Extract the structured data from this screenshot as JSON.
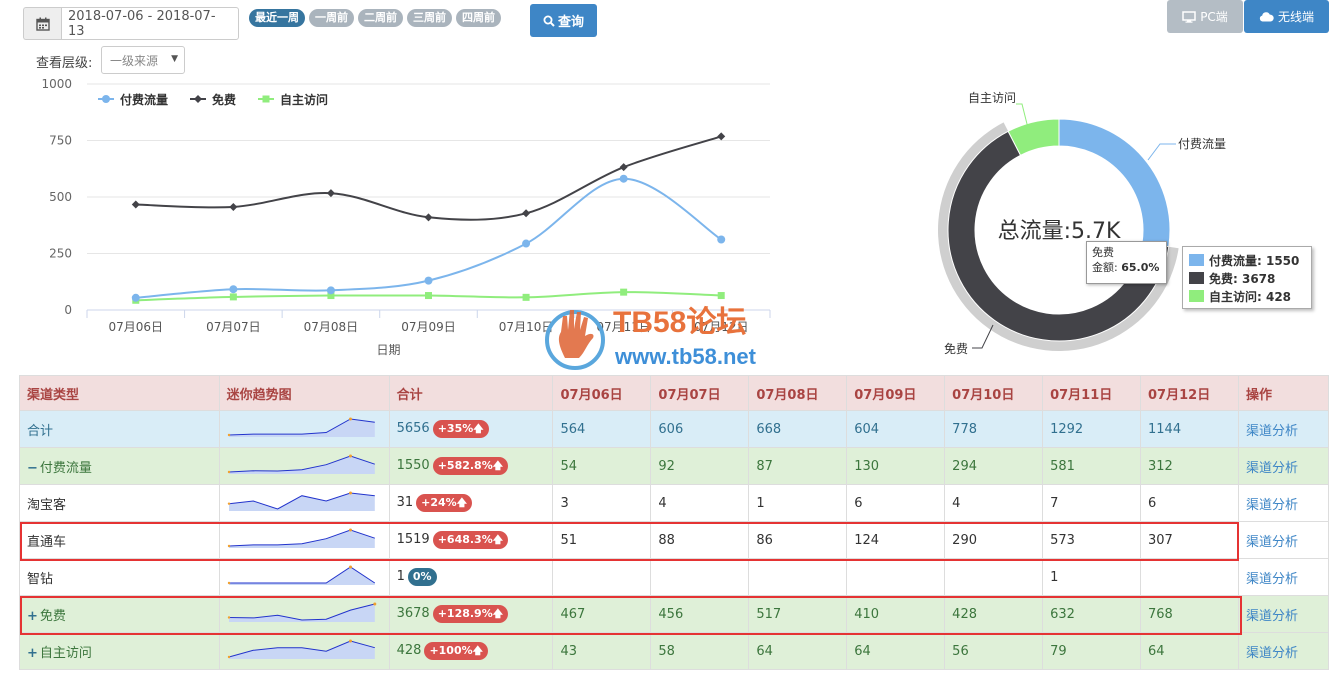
{
  "toolbar": {
    "date_range": "2018-07-06 - 2018-07-13",
    "pills": [
      "最近一周",
      "一周前",
      "二周前",
      "三周前",
      "四周前"
    ],
    "query_label": "查询",
    "pc_label": "PC端",
    "mobile_label": "无线端"
  },
  "filter": {
    "level_label": "查看层级:",
    "level_value": "一级来源"
  },
  "chart_data": [
    {
      "type": "line",
      "categories": [
        "07月06日",
        "07月07日",
        "07月08日",
        "07月09日",
        "07月10日",
        "07月11日",
        "07月12日"
      ],
      "series": [
        {
          "name": "付费流量",
          "values": [
            54,
            92,
            87,
            130,
            294,
            581,
            312
          ],
          "color": "#7cb5ec"
        },
        {
          "name": "免费",
          "values": [
            467,
            456,
            517,
            410,
            428,
            632,
            768
          ],
          "color": "#434348"
        },
        {
          "name": "自主访问",
          "values": [
            43,
            58,
            64,
            64,
            56,
            79,
            64
          ],
          "color": "#90ed7d"
        }
      ],
      "yticks": [
        0,
        250,
        500,
        750,
        1000
      ],
      "ylim": [
        0,
        1000
      ],
      "xlabel": "日期",
      "legend": "top-left"
    },
    {
      "type": "pie",
      "center_label": "总流量:5.7K",
      "slices": [
        {
          "name": "付费流量",
          "value": 1550,
          "color": "#7cb5ec"
        },
        {
          "name": "免费",
          "value": 3678,
          "color": "#434348"
        },
        {
          "name": "自主访问",
          "value": 428,
          "color": "#90ed7d"
        }
      ],
      "legend": [
        {
          "label": "付费流量: 1550"
        },
        {
          "label": "免费: 3678"
        },
        {
          "label": "自主访问: 428"
        }
      ],
      "tooltip": {
        "name": "免费",
        "metric": "金额",
        "value": "65.0%"
      }
    }
  ],
  "watermark": {
    "line1": "TB58论坛",
    "line2": "www.tb58.net"
  },
  "table": {
    "headers": [
      "渠道类型",
      "迷你趋势图",
      "合计",
      "07月06日",
      "07月07日",
      "07月08日",
      "07月09日",
      "07月10日",
      "07月11日",
      "07月12日",
      "操作"
    ],
    "rows": [
      {
        "cls": "total",
        "name": "合计",
        "expand": "",
        "total": "5656",
        "change": "+35%",
        "up": true,
        "days": [
          "564",
          "606",
          "668",
          "604",
          "778",
          "1292",
          "1144"
        ],
        "op": "渠道分析",
        "spark": [
          564,
          606,
          606,
          604,
          680,
          1292,
          1144
        ]
      },
      {
        "cls": "paid",
        "name": "付费流量",
        "expand": "−",
        "total": "1550",
        "change": "+582.8%",
        "up": true,
        "days": [
          "54",
          "92",
          "87",
          "130",
          "294",
          "581",
          "312"
        ],
        "op": "渠道分析",
        "spark": [
          54,
          92,
          87,
          130,
          294,
          581,
          312
        ]
      },
      {
        "cls": "plain",
        "name": "淘宝客",
        "expand": "",
        "total": "31",
        "change": "+24%",
        "up": true,
        "days": [
          "3",
          "4",
          "1",
          "6",
          "4",
          "7",
          "6"
        ],
        "op": "渠道分析",
        "spark": [
          3,
          4,
          1,
          6,
          4,
          7,
          6
        ]
      },
      {
        "cls": "plain",
        "name": "直通车",
        "expand": "",
        "total": "1519",
        "change": "+648.3%",
        "up": true,
        "days": [
          "51",
          "88",
          "86",
          "124",
          "290",
          "573",
          "307"
        ],
        "op": "渠道分析",
        "spark": [
          51,
          88,
          86,
          124,
          290,
          573,
          307
        ]
      },
      {
        "cls": "plain",
        "name": "智钻",
        "expand": "",
        "total": "1",
        "change": "0%",
        "up": false,
        "days": [
          "",
          "",
          "",
          "",
          "",
          "1",
          ""
        ],
        "op": "渠道分析",
        "spark": [
          0,
          0,
          0,
          0,
          0,
          1,
          0
        ]
      },
      {
        "cls": "free",
        "name": "免费",
        "expand": "+",
        "total": "3678",
        "change": "+128.9%",
        "up": true,
        "days": [
          "467",
          "456",
          "517",
          "410",
          "428",
          "632",
          "768"
        ],
        "op": "渠道分析",
        "spark": [
          467,
          456,
          517,
          410,
          428,
          632,
          768
        ]
      },
      {
        "cls": "self",
        "name": "自主访问",
        "expand": "+",
        "total": "428",
        "change": "+100%",
        "up": true,
        "days": [
          "43",
          "58",
          "64",
          "64",
          "56",
          "79",
          "64"
        ],
        "op": "渠道分析",
        "spark": [
          43,
          58,
          64,
          64,
          56,
          79,
          64
        ]
      }
    ]
  },
  "colors": {
    "primary": "#3e86c6",
    "highlight": "#e53333"
  }
}
